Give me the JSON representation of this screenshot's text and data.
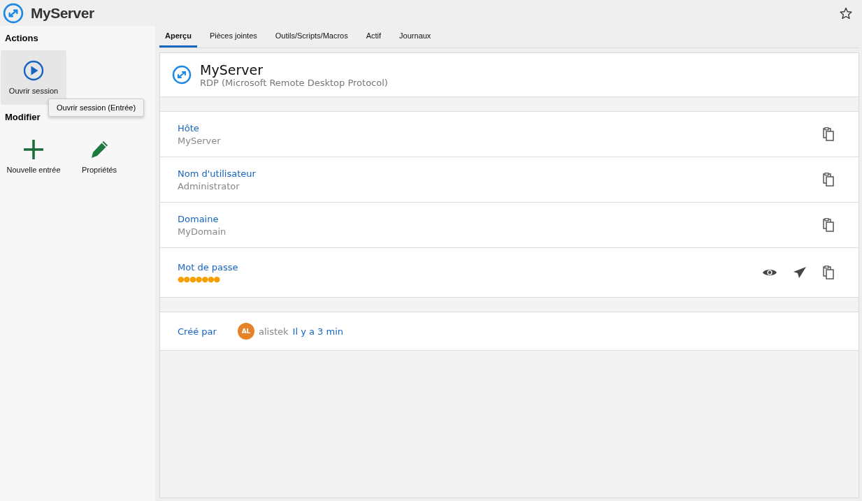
{
  "header": {
    "title": "MyServer",
    "favorite": false
  },
  "sidebar": {
    "sections": [
      {
        "title": "Actions",
        "items": [
          {
            "kind": "play",
            "label": "Ouvrir session",
            "highlighted": true
          }
        ]
      },
      {
        "title": "Modifier",
        "items": [
          {
            "kind": "add",
            "label": "Nouvelle entrée",
            "highlighted": false
          },
          {
            "kind": "edit",
            "label": "Propriétés",
            "highlighted": false
          }
        ]
      }
    ]
  },
  "tooltip": "Ouvrir session (Entrée)",
  "tabs": [
    {
      "label": "Aperçu",
      "selected": true
    },
    {
      "label": "Pièces jointes",
      "selected": false
    },
    {
      "label": "Outils/Scripts/Macros",
      "selected": false
    },
    {
      "label": "Actif",
      "selected": false
    },
    {
      "label": "Journaux",
      "selected": false
    }
  ],
  "entry": {
    "name": "MyServer",
    "type": "RDP (Microsoft Remote Desktop Protocol)"
  },
  "fields": [
    {
      "kind": "text",
      "label": "Hôte",
      "value": "MyServer"
    },
    {
      "kind": "text",
      "label": "Nom d'utilisateur",
      "value": "Administrator"
    },
    {
      "kind": "text",
      "label": "Domaine",
      "value": "MyDomain"
    },
    {
      "kind": "password",
      "label": "Mot de passe",
      "value": "●●●●●●●"
    }
  ],
  "created": {
    "label": "Créé par",
    "initials": "AL",
    "user": "alistek",
    "time": "Il y a 3 min"
  }
}
